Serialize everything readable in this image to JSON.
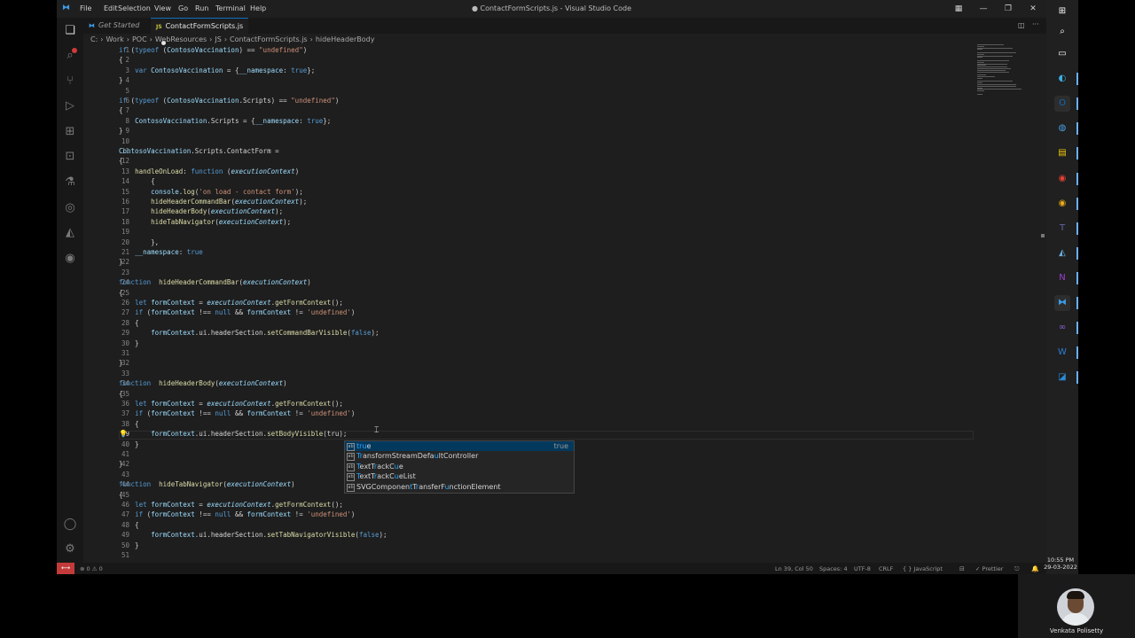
{
  "window": {
    "title": "● ContactFormScripts.js - Visual Studio Code",
    "menu": [
      "File",
      "Edit",
      "Selection",
      "View",
      "Go",
      "Run",
      "Terminal",
      "Help"
    ]
  },
  "tabs": [
    {
      "label": "Get Started",
      "icon": "vscode-icon",
      "active": false
    },
    {
      "label": "ContactFormScripts.js",
      "icon": "js-icon",
      "active": true,
      "modified": true
    }
  ],
  "breadcrumb": {
    "items": [
      "C:",
      "Work",
      "POC",
      "WebResources",
      "JS",
      "ContactFormScripts.js",
      "hideHeaderBody"
    ],
    "separator": "›"
  },
  "editor": {
    "current_line": 39,
    "lines": [
      "if (typeof (ContosoVaccination) == \"undefined\")",
      "{",
      "    var ContosoVaccination = {__namespace: true};",
      "}",
      "",
      "if (typeof (ContosoVaccination.Scripts) == \"undefined\")",
      "{",
      "    ContosoVaccination.Scripts = {__namespace: true};",
      "}",
      "",
      "ContosoVaccination.Scripts.ContactForm =",
      "{",
      "    handleOnLoad: function (executionContext)",
      "        {",
      "        console.log('on load - contact form');",
      "        hideHeaderCommandBar(executionContext);",
      "        hideHeaderBody(executionContext);",
      "        hideTabNavigator(executionContext);",
      "",
      "        },",
      "    __namespace: true",
      "}",
      "",
      "function  hideHeaderCommandBar(executionContext)",
      "{",
      "    let formContext = executionContext.getFormContext();",
      "    if (formContext !== null && formContext != 'undefined')",
      "    {",
      "        formContext.ui.headerSection.setCommandBarVisible(false);",
      "    }",
      "",
      "}",
      "",
      "function  hideHeaderBody(executionContext)",
      "{",
      "    let formContext = executionContext.getFormContext();",
      "    if (formContext !== null && formContext != 'undefined')",
      "    {",
      "        formContext.ui.headerSection.setBodyVisible(tru);",
      "    }",
      "",
      "}",
      "",
      "function  hideTabNavigator(executionContext)",
      "{",
      "    let formContext = executionContext.getFormContext();",
      "    if (formContext !== null && formContext != 'undefined')",
      "    {",
      "        formContext.ui.headerSection.setTabNavigatorVisible(false);",
      "    }",
      ""
    ]
  },
  "suggestions": [
    {
      "label": "true",
      "detail": "true",
      "selected": true
    },
    {
      "label": "TransformStreamDefaultController",
      "detail": ""
    },
    {
      "label": "TextTrackCue",
      "detail": ""
    },
    {
      "label": "TextTrackCueList",
      "detail": ""
    },
    {
      "label": "SVGComponentTransferFunctionElement",
      "detail": ""
    }
  ],
  "statusbar": {
    "problems": "⊗ 0  ⚠ 0",
    "position": "Ln 39, Col 50",
    "spaces": "Spaces: 4",
    "encoding": "UTF-8",
    "eol": "CRLF",
    "language": "{ }  JavaScript",
    "prettier": "✓ Prettier"
  },
  "taskbar": {
    "time": "10:55 PM",
    "date": "29-03-2022",
    "apps": [
      "windows-icon",
      "search-icon",
      "task-view-icon",
      "edge-icon",
      "outlook-icon",
      "people-icon",
      "sticky-notes-icon",
      "chrome-icon",
      "chrome-canary-icon",
      "teams-icon",
      "azure-icon",
      "onenote-icon",
      "vscode-icon",
      "visual-studio-icon",
      "word-icon",
      "photos-icon"
    ]
  },
  "webcam": {
    "name": "Venkata Polisetty"
  },
  "colors": {
    "accent": "#0e70c0",
    "remote": "#c33a3a",
    "keyword": "#569cd6",
    "function": "#dcdcaa",
    "string": "#ce9178"
  }
}
